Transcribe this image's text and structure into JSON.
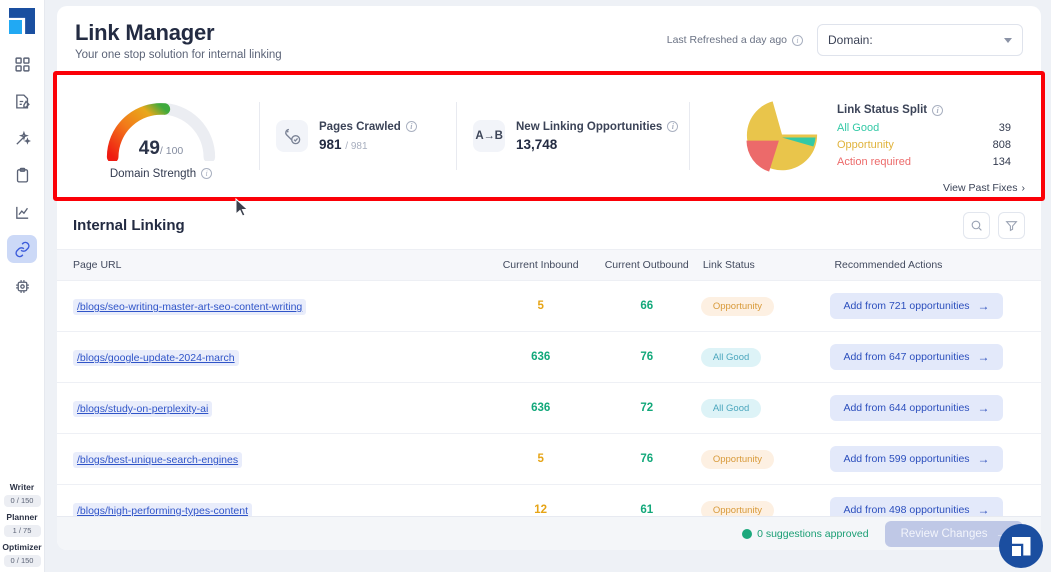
{
  "sidebar": {
    "logo_name": "app-logo",
    "items": [
      {
        "name": "dashboard",
        "icon": "grid-icon"
      },
      {
        "name": "writer",
        "icon": "document-edit-icon"
      },
      {
        "name": "ai-assist",
        "icon": "magic-wand-icon"
      },
      {
        "name": "planner",
        "icon": "clipboard-icon"
      },
      {
        "name": "analytics",
        "icon": "chart-line-icon"
      },
      {
        "name": "link-manager",
        "icon": "link-icon",
        "active": true
      },
      {
        "name": "optimizer",
        "icon": "chip-icon"
      }
    ],
    "meters": [
      {
        "label": "Writer",
        "value": "0 / 150"
      },
      {
        "label": "Planner",
        "value": "1 / 75"
      },
      {
        "label": "Optimizer",
        "value": "0 / 150"
      }
    ]
  },
  "header": {
    "title": "Link Manager",
    "subtitle": "Your one stop solution for internal linking",
    "last_refreshed": "Last Refreshed a day ago",
    "domain_label": "Domain:"
  },
  "stats": {
    "gauge": {
      "value": "49",
      "suffix": "/ 100",
      "caption": "Domain Strength",
      "percent": 49
    },
    "pages_crawled": {
      "title": "Pages Crawled",
      "value": "981",
      "total": "/ 981",
      "icon": "wrench-check-icon"
    },
    "new_opportunities": {
      "title": "New Linking Opportunities",
      "value": "13,748",
      "icon": "a-to-b-icon"
    },
    "link_status_split": {
      "title": "Link Status Split",
      "rows": [
        {
          "label": "All Good",
          "value": "39",
          "color": "#33c9a6"
        },
        {
          "label": "Opportunity",
          "value": "808",
          "color": "#e9c54b"
        },
        {
          "label": "Action required",
          "value": "134",
          "color": "#ec6a6a"
        }
      ]
    },
    "view_past_fixes": "View Past Fixes"
  },
  "chart_data": {
    "type": "pie",
    "title": "Link Status Split",
    "labels": [
      "All Good",
      "Opportunity",
      "Action required"
    ],
    "values": [
      39,
      808,
      134
    ],
    "colors": [
      "#33c9a6",
      "#e9c54b",
      "#ec6a6a"
    ],
    "legend": "right",
    "exploded": [
      "Action required"
    ]
  },
  "internal_linking": {
    "title": "Internal Linking",
    "search_icon": "search-icon",
    "filter_icon": "filter-icon",
    "columns": [
      "Page URL",
      "Current Inbound",
      "Current Outbound",
      "Link Status",
      "Recommended Actions"
    ],
    "rows": [
      {
        "url": "/blogs/seo-writing-master-art-seo-content-writing",
        "inbound": "5",
        "inbound_state": "low",
        "outbound": "66",
        "status": "Opportunity",
        "status_kind": "opportunity",
        "action": "Add from 721 opportunities"
      },
      {
        "url": "/blogs/google-update-2024-march",
        "inbound": "636",
        "inbound_state": "good",
        "outbound": "76",
        "status": "All Good",
        "status_kind": "allgood",
        "action": "Add from 647 opportunities"
      },
      {
        "url": "/blogs/study-on-perplexity-ai",
        "inbound": "636",
        "inbound_state": "good",
        "outbound": "72",
        "status": "All Good",
        "status_kind": "allgood",
        "action": "Add from 644 opportunities"
      },
      {
        "url": "/blogs/best-unique-search-engines",
        "inbound": "5",
        "inbound_state": "low",
        "outbound": "76",
        "status": "Opportunity",
        "status_kind": "opportunity",
        "action": "Add from 599 opportunities"
      },
      {
        "url": "/blogs/high-performing-types-content",
        "inbound": "12",
        "inbound_state": "low",
        "outbound": "61",
        "status": "Opportunity",
        "status_kind": "opportunity",
        "action": "Add from 498 opportunities"
      }
    ]
  },
  "footer": {
    "approved_text": "0 suggestions approved",
    "review_button": "Review Changes"
  }
}
